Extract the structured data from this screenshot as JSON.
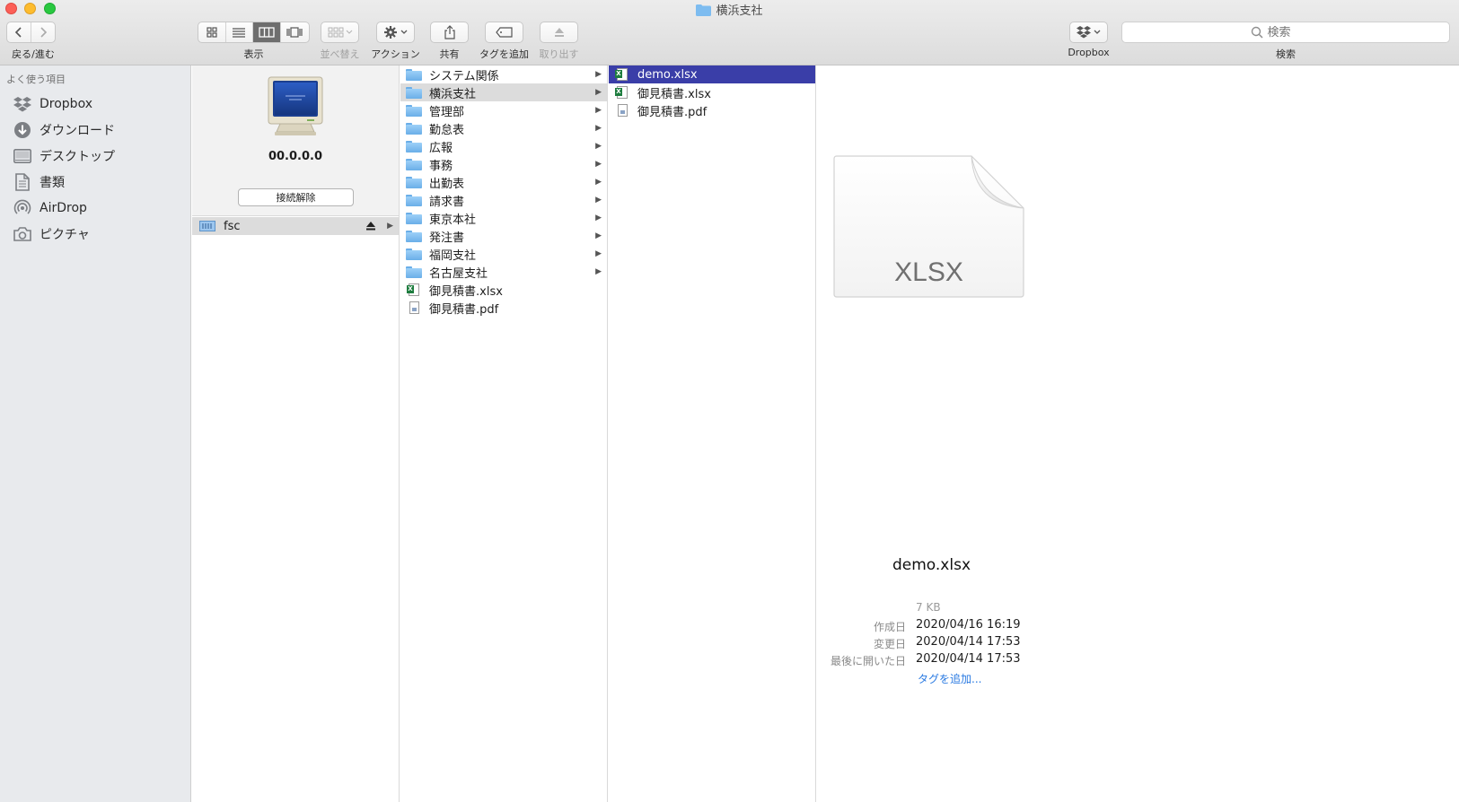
{
  "window": {
    "title": "横浜支社"
  },
  "toolbar": {
    "back_forward_label": "戻る/進む",
    "view_label": "表示",
    "arrange_label": "並べ替え",
    "action_label": "アクション",
    "share_label": "共有",
    "add_tag_label": "タグを追加",
    "eject_label": "取り出す",
    "dropbox_label": "Dropbox",
    "search_label": "検索",
    "search_placeholder": "検索"
  },
  "sidebar": {
    "heading": "よく使う項目",
    "items": [
      {
        "label": "Dropbox",
        "icon": "dropbox-icon"
      },
      {
        "label": "ダウンロード",
        "icon": "download-icon"
      },
      {
        "label": "デスクトップ",
        "icon": "desktop-icon"
      },
      {
        "label": "書類",
        "icon": "document-icon"
      },
      {
        "label": "AirDrop",
        "icon": "airdrop-icon"
      },
      {
        "label": "ピクチャ",
        "icon": "camera-icon"
      }
    ]
  },
  "server": {
    "ip": "00.0.0.0",
    "disconnect_label": "接続解除",
    "share_name": "fsc"
  },
  "column1": [
    {
      "name": "システム関係",
      "type": "folder"
    },
    {
      "name": "横浜支社",
      "type": "folder"
    },
    {
      "name": "管理部",
      "type": "folder"
    },
    {
      "name": "勤怠表",
      "type": "folder"
    },
    {
      "name": "広報",
      "type": "folder"
    },
    {
      "name": "事務",
      "type": "folder"
    },
    {
      "name": "出勤表",
      "type": "folder"
    },
    {
      "name": "請求書",
      "type": "folder"
    },
    {
      "name": "東京本社",
      "type": "folder"
    },
    {
      "name": "発注書",
      "type": "folder"
    },
    {
      "name": "福岡支社",
      "type": "folder"
    },
    {
      "name": "名古屋支社",
      "type": "folder"
    },
    {
      "name": "御見積書.xlsx",
      "type": "xlsx"
    },
    {
      "name": "御見積書.pdf",
      "type": "pdf"
    }
  ],
  "column2": [
    {
      "name": "demo.xlsx",
      "type": "xlsx"
    },
    {
      "name": "御見積書.xlsx",
      "type": "xlsx"
    },
    {
      "name": "御見積書.pdf",
      "type": "pdf"
    }
  ],
  "preview": {
    "doc_type": "XLSX",
    "file_name": "demo.xlsx",
    "size": "7 KB",
    "created_label": "作成日",
    "created": "2020/04/16 16:19",
    "modified_label": "変更日",
    "modified": "2020/04/14 17:53",
    "opened_label": "最後に開いた日",
    "opened": "2020/04/14 17:53",
    "add_tag_link": "タグを追加..."
  },
  "colors": {
    "selection_blue": "#3a3ea8",
    "folder_blue": "#6aaee8",
    "link_blue": "#2a7ae2"
  }
}
